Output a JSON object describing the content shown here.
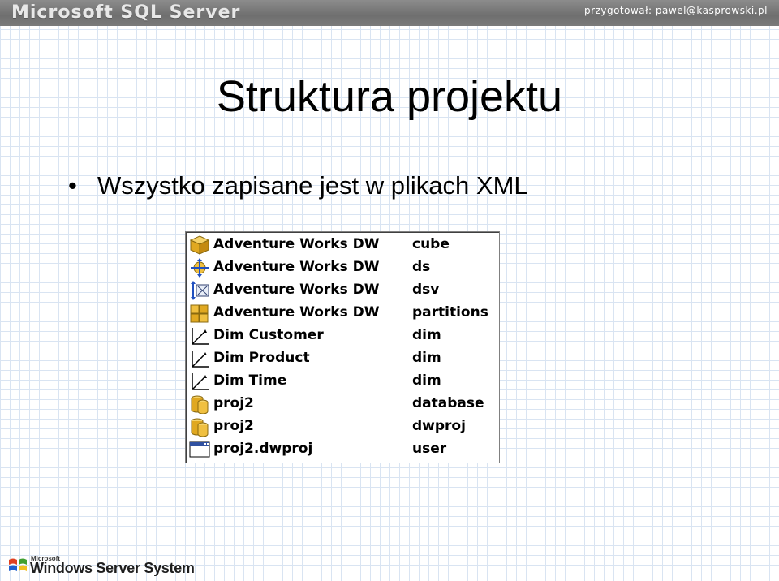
{
  "header": {
    "brand": "Microsoft SQL Server",
    "credit": "przygotował: pawel@kasprowski.pl"
  },
  "slide": {
    "title": "Struktura projektu",
    "bullets": [
      "Wszystko zapisane jest w plikach XML"
    ]
  },
  "files": [
    {
      "name": "Adventure Works DW",
      "type": "cube",
      "icon": "cube-icon"
    },
    {
      "name": "Adventure Works DW",
      "type": "ds",
      "icon": "data-source-icon"
    },
    {
      "name": "Adventure Works DW",
      "type": "dsv",
      "icon": "data-source-view-icon"
    },
    {
      "name": "Adventure Works DW",
      "type": "partitions",
      "icon": "partitions-icon"
    },
    {
      "name": "Dim Customer",
      "type": "dim",
      "icon": "dimension-icon"
    },
    {
      "name": "Dim Product",
      "type": "dim",
      "icon": "dimension-icon"
    },
    {
      "name": "Dim Time",
      "type": "dim",
      "icon": "dimension-icon"
    },
    {
      "name": "proj2",
      "type": "database",
      "icon": "database-icon"
    },
    {
      "name": "proj2",
      "type": "dwproj",
      "icon": "database-icon"
    },
    {
      "name": "proj2.dwproj",
      "type": "user",
      "icon": "window-icon"
    }
  ],
  "footer": {
    "microsoft": "Microsoft",
    "product": "Windows Server System"
  },
  "colors": {
    "grid": "#d9e4f2",
    "header": "#7a7a7a",
    "icon_gold": "#e8b830"
  }
}
